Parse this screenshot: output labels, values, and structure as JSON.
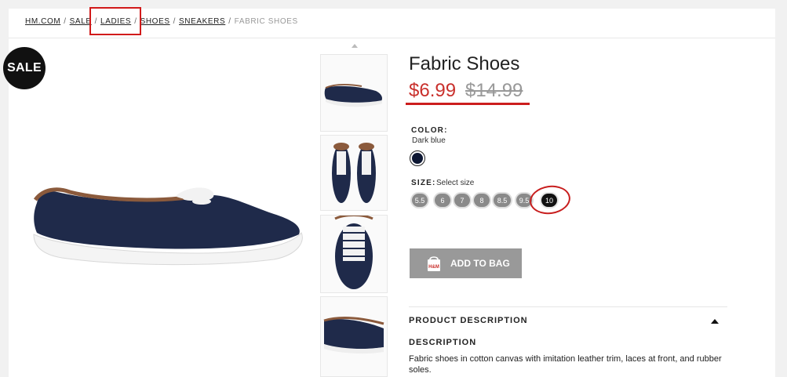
{
  "breadcrumb": {
    "items": [
      "HM.COM",
      "SALE",
      "LADIES",
      "SHOES",
      "SNEAKERS"
    ],
    "current": "FABRIC SHOES",
    "separator": "/"
  },
  "badge": {
    "label": "SALE"
  },
  "product": {
    "title": "Fabric Shoes",
    "price_sale": "$6.99",
    "price_original": "$14.99",
    "color_label": "COLOR:",
    "color_value": "Dark blue",
    "size_label": "SIZE:",
    "size_prompt": "Select size",
    "sizes": [
      "5.5",
      "6",
      "7",
      "8",
      "8.5",
      "9.5",
      "10"
    ],
    "selected_size": "10",
    "add_to_bag": "ADD TO BAG",
    "bag_icon_text": "H&M",
    "description_header": "PRODUCT DESCRIPTION",
    "description_subheader": "DESCRIPTION",
    "description_text": "Fabric shoes in cotton canvas with imitation leather trim, laces at front, and rubber soles."
  },
  "colors": {
    "price_sale": "#c9302c",
    "price_original": "#999999",
    "shoe_canvas": "#1f2a4a",
    "shoe_trim": "#8b5a3c",
    "button": "#999999",
    "annotation": "#d11a1a"
  },
  "icons": [
    "chevron-up-icon",
    "shopping-bag-icon",
    "caret-up-icon"
  ]
}
